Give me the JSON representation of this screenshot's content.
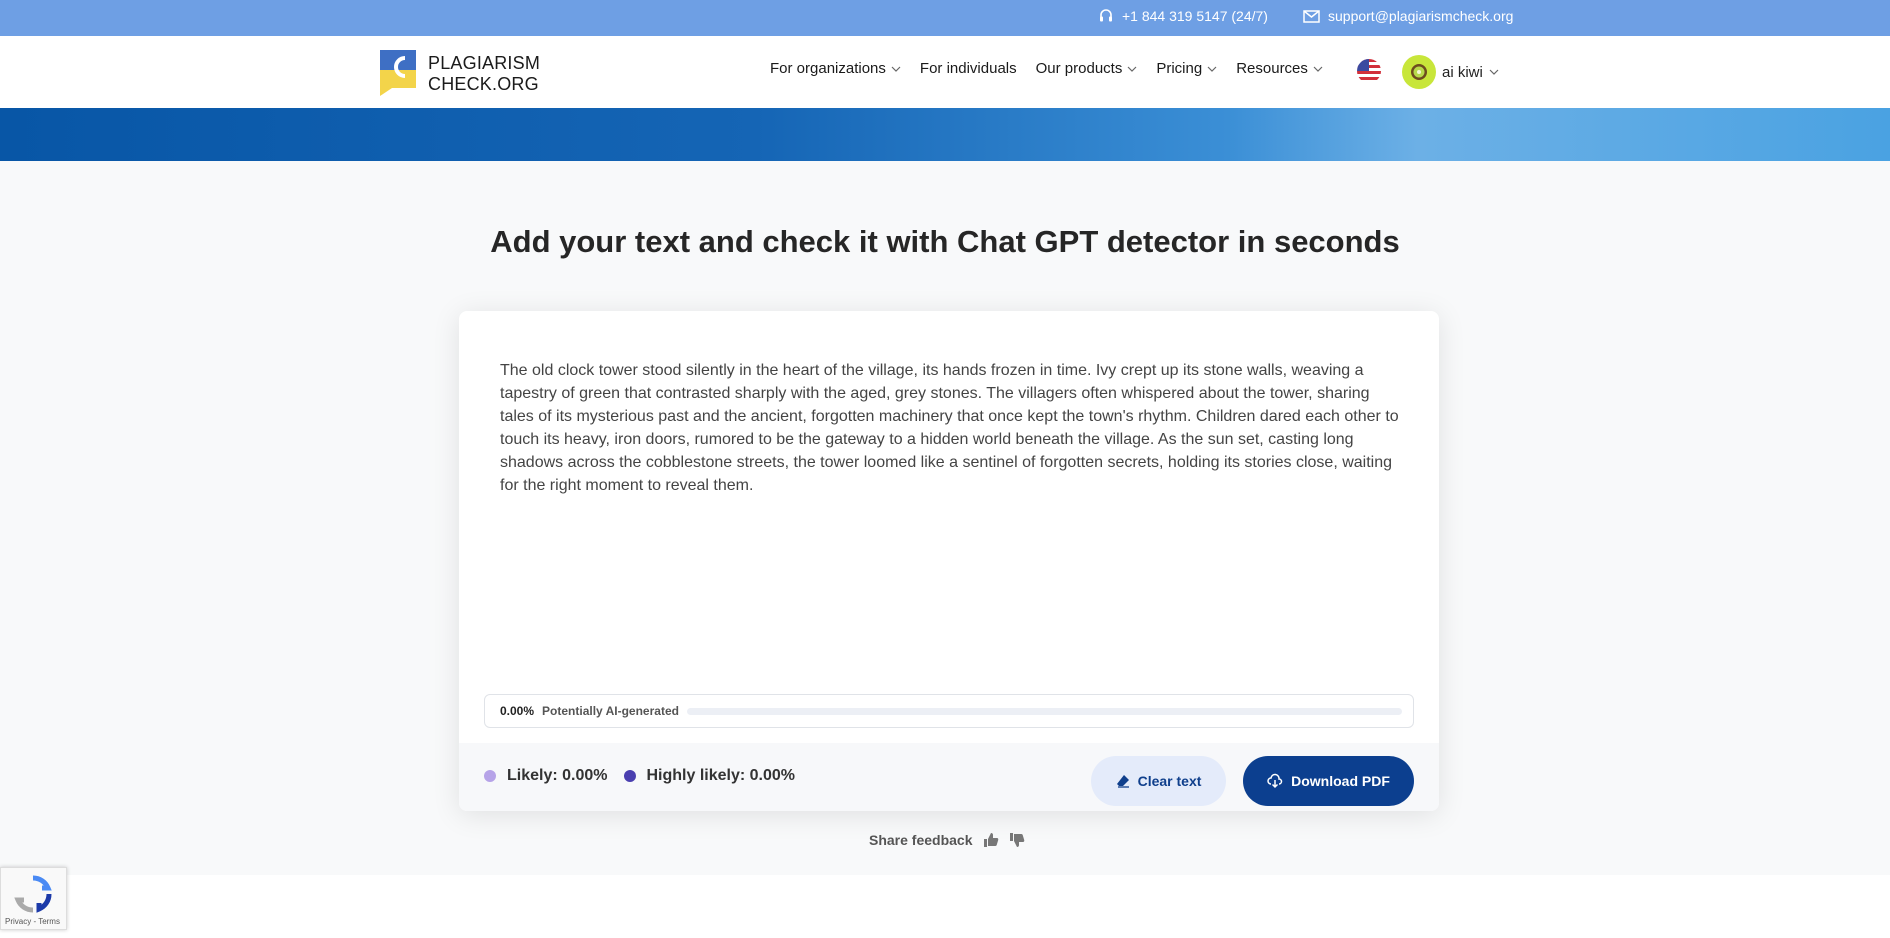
{
  "topbar": {
    "phone": "+1 844 319 5147 (24/7)",
    "email": "support@plagiarismcheck.org"
  },
  "header": {
    "logo_line1": "PLAGIARISM",
    "logo_line2": "CHECK.ORG",
    "nav": [
      {
        "label": "For organizations",
        "has_dropdown": true
      },
      {
        "label": "For individuals",
        "has_dropdown": false
      },
      {
        "label": "Our products",
        "has_dropdown": true
      },
      {
        "label": "Pricing",
        "has_dropdown": true
      },
      {
        "label": "Resources",
        "has_dropdown": true
      }
    ],
    "user_name": "ai kiwi"
  },
  "main": {
    "heading": "Add your text and check it with Chat GPT detector in seconds",
    "input_text": "The old clock tower stood silently in the heart of the village, its hands frozen in time. Ivy crept up its stone walls, weaving a tapestry of green that contrasted sharply with the aged, grey stones. The villagers often whispered about the tower, sharing tales of its mysterious past and the ancient, forgotten machinery that once kept the town's rhythm. Children dared each other to touch its heavy, iron doors, rumored to be the gateway to a hidden world beneath the village. As the sun set, casting long shadows across the cobblestone streets, the tower loomed like a sentinel of forgotten secrets, holding its stories close, waiting for the right moment to reveal them.",
    "meter": {
      "percent": "0.00%",
      "label": "Potentially AI-generated",
      "value": 0
    },
    "legend": {
      "likely": "Likely: 0.00%",
      "highly_likely": "Highly likely: 0.00%"
    },
    "clear_label": "Clear text",
    "download_label": "Download PDF"
  },
  "feedback": {
    "label": "Share feedback"
  },
  "recaptcha": {
    "links": "Privacy - Terms"
  },
  "colors": {
    "topbar": "#6e9fe4",
    "primary": "#0c3f8f",
    "likely_dot": "#b6a3e8",
    "highly_likely_dot": "#4a3fb0",
    "avatar": "#c8e63a"
  }
}
